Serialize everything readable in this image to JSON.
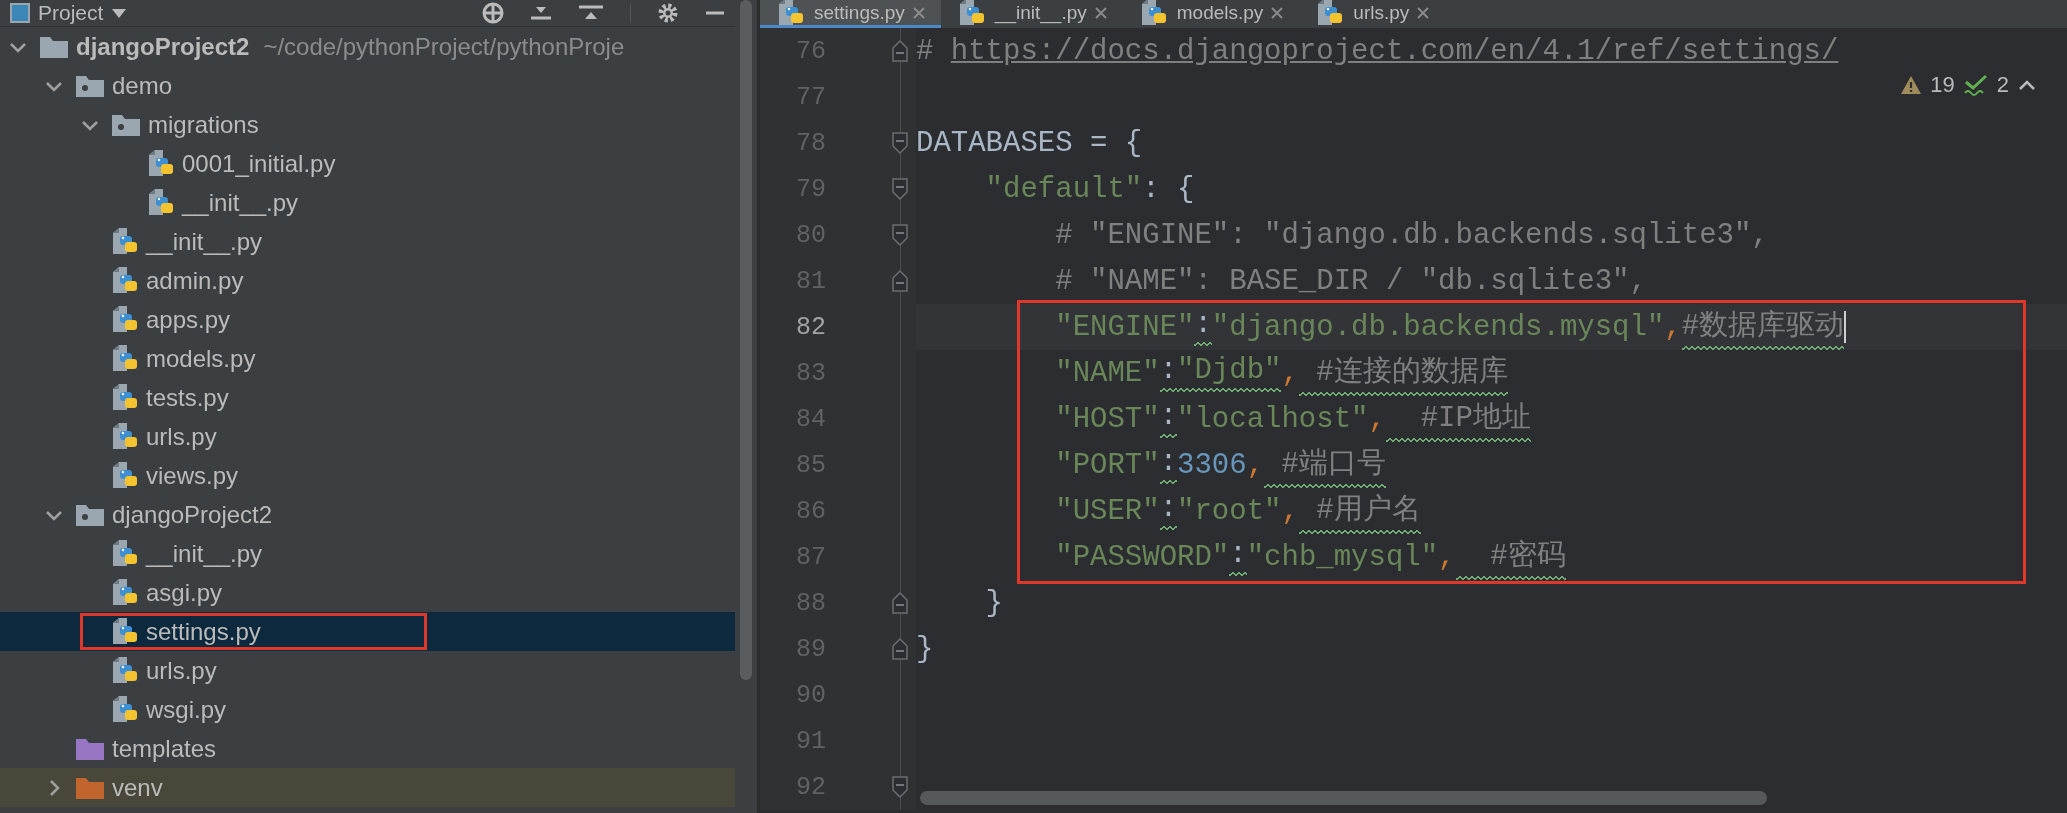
{
  "project_panel": {
    "title": "Project",
    "tree": [
      {
        "name": "djangoProject2",
        "path": "~/code/pythonProject/pythonProje",
        "kind": "project",
        "expanded": true,
        "selected": false,
        "children": [
          {
            "name": "demo",
            "kind": "package",
            "expanded": true,
            "selected": false,
            "children": [
              {
                "name": "migrations",
                "kind": "package",
                "expanded": true,
                "selected": false,
                "children": [
                  {
                    "name": "0001_initial.py",
                    "kind": "python",
                    "selected": false
                  },
                  {
                    "name": "__init__.py",
                    "kind": "python",
                    "selected": false
                  }
                ]
              },
              {
                "name": "__init__.py",
                "kind": "python",
                "selected": false
              },
              {
                "name": "admin.py",
                "kind": "python",
                "selected": false
              },
              {
                "name": "apps.py",
                "kind": "python",
                "selected": false
              },
              {
                "name": "models.py",
                "kind": "python",
                "selected": false
              },
              {
                "name": "tests.py",
                "kind": "python",
                "selected": false
              },
              {
                "name": "urls.py",
                "kind": "python",
                "selected": false
              },
              {
                "name": "views.py",
                "kind": "python",
                "selected": false
              }
            ]
          },
          {
            "name": "djangoProject2",
            "kind": "package",
            "expanded": true,
            "selected": false,
            "children": [
              {
                "name": "__init__.py",
                "kind": "python",
                "selected": false
              },
              {
                "name": "asgi.py",
                "kind": "python",
                "selected": false
              },
              {
                "name": "settings.py",
                "kind": "python",
                "selected": true,
                "highlighted": true
              },
              {
                "name": "urls.py",
                "kind": "python",
                "selected": false
              },
              {
                "name": "wsgi.py",
                "kind": "python",
                "selected": false
              }
            ]
          },
          {
            "name": "templates",
            "kind": "template-folder",
            "selected": false
          },
          {
            "name": "venv",
            "kind": "excluded-folder",
            "expanded": false,
            "selected": false
          }
        ]
      }
    ]
  },
  "editor": {
    "tabs": [
      {
        "label": "settings.py",
        "selected": true
      },
      {
        "label": "__init__.py",
        "selected": false
      },
      {
        "label": "models.py",
        "selected": false
      },
      {
        "label": "urls.py",
        "selected": false
      }
    ],
    "inspections": {
      "warnings": "19",
      "typos": "2"
    },
    "lines": [
      {
        "number": "76",
        "current": false,
        "fold_end": true,
        "tokens": [
          {
            "text": "# ",
            "kind": "comment"
          },
          {
            "text": "https://docs.djangoproject.com/en/4.1/ref/settings/",
            "kind": "link"
          }
        ]
      },
      {
        "number": "77",
        "current": false
      },
      {
        "number": "78",
        "current": false,
        "fold_start": true,
        "tokens": [
          {
            "text": "DATABASES = {",
            "kind": "ident"
          }
        ]
      },
      {
        "number": "79",
        "current": false,
        "fold_start": true,
        "tokens": [
          {
            "text": "    \"default\"",
            "kind": "string"
          },
          {
            "text": ": {",
            "kind": "ident"
          }
        ]
      },
      {
        "number": "80",
        "current": false,
        "fold_start": true,
        "tokens": [
          {
            "text": "        # \"ENGINE\": \"django.db.backends.sqlite3\",",
            "kind": "comment"
          }
        ]
      },
      {
        "number": "81",
        "current": false,
        "fold_end": true,
        "tokens": [
          {
            "text": "        # \"NAME\": BASE_DIR / \"db.sqlite3\",",
            "kind": "comment"
          }
        ]
      },
      {
        "number": "82",
        "current": true,
        "highlighted": true,
        "tokens": [
          {
            "text": "        \"ENGINE\"",
            "kind": "string"
          },
          {
            "text": ":",
            "kind": "ident",
            "typo": true
          },
          {
            "text": "\"django.db.backends.mysql\"",
            "kind": "string"
          },
          {
            "text": ",",
            "kind": "punct"
          },
          {
            "text": "#数据库驱动",
            "kind": "comment",
            "typo": true
          }
        ]
      },
      {
        "number": "83",
        "current": false,
        "highlighted": true,
        "tokens": [
          {
            "text": "        \"NAME\"",
            "kind": "string"
          },
          {
            "text": ":",
            "kind": "ident",
            "typo": true
          },
          {
            "text": "\"Djdb\"",
            "kind": "string",
            "typo": true
          },
          {
            "text": ",",
            "kind": "punct"
          },
          {
            "text": " #连接的数据库",
            "kind": "comment",
            "typo": true
          }
        ]
      },
      {
        "number": "84",
        "current": false,
        "highlighted": true,
        "tokens": [
          {
            "text": "        \"HOST\"",
            "kind": "string"
          },
          {
            "text": ":",
            "kind": "ident",
            "typo": true
          },
          {
            "text": "\"localhost\"",
            "kind": "string"
          },
          {
            "text": ",",
            "kind": "punct"
          },
          {
            "text": "  #IP地址",
            "kind": "comment",
            "typo": true
          }
        ]
      },
      {
        "number": "85",
        "current": false,
        "highlighted": true,
        "tokens": [
          {
            "text": "        \"PORT\"",
            "kind": "string"
          },
          {
            "text": ":",
            "kind": "ident",
            "typo": true
          },
          {
            "text": "3306",
            "kind": "number"
          },
          {
            "text": ",",
            "kind": "punct"
          },
          {
            "text": " #端口号",
            "kind": "comment",
            "typo": true
          }
        ]
      },
      {
        "number": "86",
        "current": false,
        "highlighted": true,
        "tokens": [
          {
            "text": "        \"USER\"",
            "kind": "string"
          },
          {
            "text": ":",
            "kind": "ident",
            "typo": true
          },
          {
            "text": "\"root\"",
            "kind": "string"
          },
          {
            "text": ",",
            "kind": "punct"
          },
          {
            "text": " #用户名",
            "kind": "comment",
            "typo": true
          }
        ]
      },
      {
        "number": "87",
        "current": false,
        "highlighted": true,
        "tokens": [
          {
            "text": "        \"PASSWORD\"",
            "kind": "string"
          },
          {
            "text": ":",
            "kind": "ident",
            "typo": true
          },
          {
            "text": "\"chb_mysql\"",
            "kind": "string"
          },
          {
            "text": ",",
            "kind": "punct"
          },
          {
            "text": "  #密码",
            "kind": "comment",
            "typo": true
          }
        ]
      },
      {
        "number": "88",
        "current": false,
        "fold_end": true,
        "tokens": [
          {
            "text": "    }",
            "kind": "ident"
          }
        ]
      },
      {
        "number": "89",
        "current": false,
        "fold_end": true,
        "tokens": [
          {
            "text": "}",
            "kind": "ident"
          }
        ]
      },
      {
        "number": "90",
        "current": false
      },
      {
        "number": "91",
        "current": false
      },
      {
        "number": "92",
        "current": false,
        "fold_start": true
      }
    ]
  }
}
